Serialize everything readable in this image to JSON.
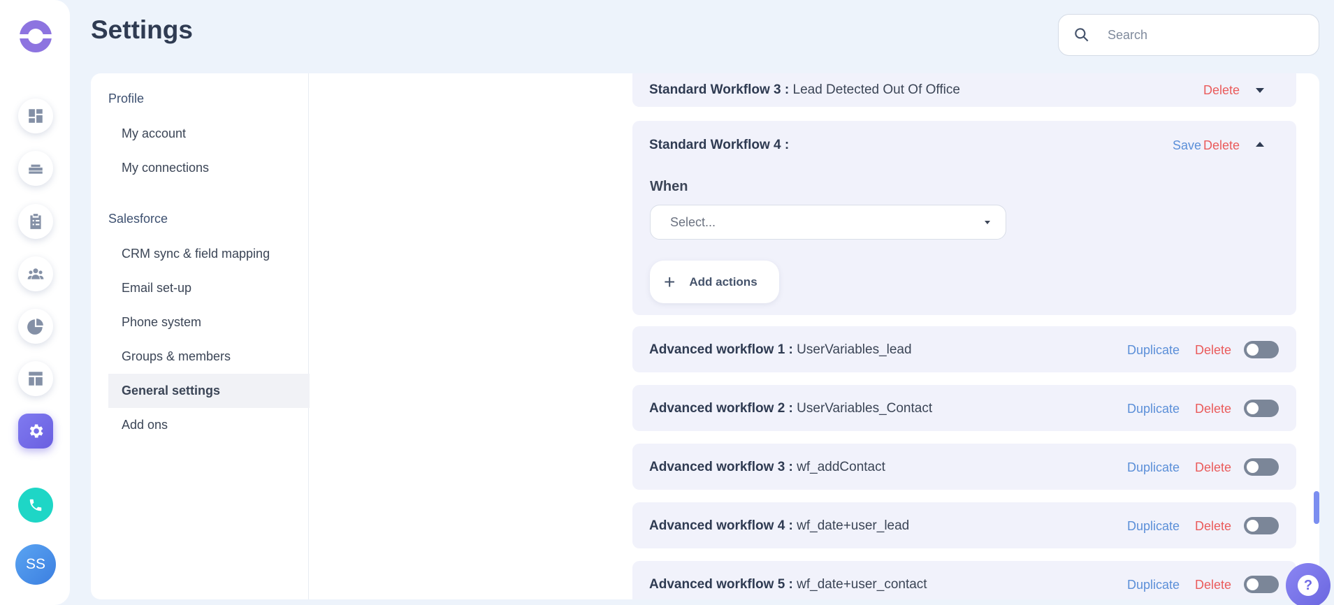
{
  "header": {
    "title": "Settings",
    "search_placeholder": "Search"
  },
  "rail": {
    "items": [
      "dashboard-icon",
      "layers-icon",
      "clipboard-icon",
      "team-icon",
      "pie-chart-icon",
      "layout-icon",
      "gear-icon"
    ],
    "active": "gear-icon",
    "avatar_initials": "SS"
  },
  "nav": {
    "sections": [
      {
        "heading": "Profile",
        "items": [
          "My account",
          "My connections"
        ]
      },
      {
        "heading": "Salesforce",
        "items": [
          "CRM sync & field mapping",
          "Email set-up",
          "Phone system",
          "Groups & members",
          "General settings",
          "Add ons"
        ]
      }
    ],
    "active_item": "General settings"
  },
  "workflows": {
    "standard": [
      {
        "name": "Standard Workflow 3 :",
        "value": "Lead Detected Out Of Office",
        "delete": "Delete",
        "expanded": false
      },
      {
        "name": "Standard Workflow 4 :",
        "value": "",
        "save": "Save",
        "delete": "Delete",
        "expanded": true,
        "when_label": "When",
        "select_placeholder": "Select...",
        "add_actions": "Add actions"
      }
    ],
    "advanced": [
      {
        "name": "Advanced workflow 1 :",
        "value": "UserVariables_lead",
        "duplicate": "Duplicate",
        "delete": "Delete",
        "enabled": false
      },
      {
        "name": "Advanced workflow 2 :",
        "value": "UserVariables_Contact",
        "duplicate": "Duplicate",
        "delete": "Delete",
        "enabled": false
      },
      {
        "name": "Advanced workflow 3 :",
        "value": "wf_addContact",
        "duplicate": "Duplicate",
        "delete": "Delete",
        "enabled": false
      },
      {
        "name": "Advanced workflow 4 :",
        "value": "wf_date+user_lead",
        "duplicate": "Duplicate",
        "delete": "Delete",
        "enabled": false
      },
      {
        "name": "Advanced workflow 5 :",
        "value": "wf_date+user_contact",
        "duplicate": "Duplicate",
        "delete": "Delete",
        "enabled": false
      }
    ]
  },
  "colors": {
    "accent": "#6f6ae5",
    "delete": "#ea5b5b",
    "link": "#5b8fd8",
    "call": "#1ed6c6"
  }
}
